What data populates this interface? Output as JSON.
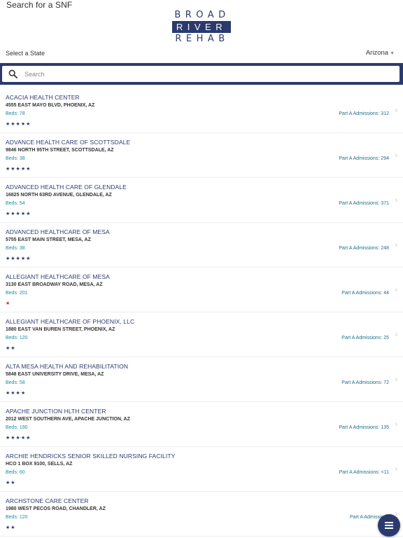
{
  "header": {
    "title": "Search for a SNF",
    "logo": {
      "line1": "BROAD",
      "line2": "RIVER",
      "line3": "REHAB"
    }
  },
  "state_selector": {
    "label": "Select a State",
    "value": "Arizona",
    "icon": "chevron-down-icon"
  },
  "search": {
    "placeholder": "Search",
    "value": "",
    "icon": "search-icon"
  },
  "colors": {
    "brand": "#2b3a6e",
    "beds": "#1f8ba3",
    "admissions": "#1f6f8b",
    "star_low": "#c7254e"
  },
  "facilities": [
    {
      "name": "ACACIA HEALTH CENTER",
      "address": "4555 EAST MAYO BLVD, PHOENIX, AZ",
      "beds": "Beds: 78",
      "admissions": "Part A Admissions: 312",
      "stars": "★★★★★",
      "rating": 5
    },
    {
      "name": "ADVANCE HEALTH CARE OF SCOTTSDALE",
      "address": "9846 NORTH 95TH STREET, SCOTTSDALE, AZ",
      "beds": "Beds: 38",
      "admissions": "Part A Admissions: 294",
      "stars": "★★★★★",
      "rating": 5
    },
    {
      "name": "ADVANCED HEALTH CARE OF GLENDALE",
      "address": "16825 NORTH 63RD AVENUE, GLENDALE, AZ",
      "beds": "Beds: 54",
      "admissions": "Part A Admissions: 371",
      "stars": "★★★★★",
      "rating": 5
    },
    {
      "name": "ADVANCED HEALTHCARE OF MESA",
      "address": "5755 EAST MAIN STREET, MESA, AZ",
      "beds": "Beds: 38",
      "admissions": "Part A Admissions: 248",
      "stars": "★★★★★",
      "rating": 5
    },
    {
      "name": "ALLEGIANT HEALTHCARE OF MESA",
      "address": "3130 EAST BROADWAY ROAD, MESA, AZ",
      "beds": "Beds: 201",
      "admissions": "Part A Admissions: 44",
      "stars": "★",
      "rating": 1
    },
    {
      "name": "ALLEGIANT HEALTHCARE OF PHOENIX, LLC",
      "address": "1880 EAST VAN BUREN STREET, PHOENIX, AZ",
      "beds": "Beds: 120",
      "admissions": "Part A Admissions: 25",
      "stars": "★★",
      "rating": 2
    },
    {
      "name": "ALTA MESA HEALTH AND REHABILITATION",
      "address": "5848 EAST UNIVERSITY DRIVE, MESA, AZ",
      "beds": "Beds: 58",
      "admissions": "Part A Admissions: 72",
      "stars": "★★★★",
      "rating": 4
    },
    {
      "name": "APACHE JUNCTION HLTH CENTER",
      "address": "2012 WEST SOUTHERN AVE, APACHE JUNCTION, AZ",
      "beds": "Beds: 190",
      "admissions": "Part A Admissions: 135",
      "stars": "★★★★★",
      "rating": 5
    },
    {
      "name": "ARCHIE HENDRICKS SENIOR SKILLED NURSING FACILITY",
      "address": "HCO 1 BOX 9100, SELLS, AZ",
      "beds": "Beds: 60",
      "admissions": "Part A Admissions: <11",
      "stars": "★★",
      "rating": 2
    },
    {
      "name": "ARCHSTONE CARE CENTER",
      "address": "1980 WEST PECOS ROAD, CHANDLER, AZ",
      "beds": "Beds: 120",
      "admissions": "Part A Admissions",
      "stars": "★★",
      "rating": 2
    }
  ],
  "fab": {
    "icon": "menu-icon"
  }
}
